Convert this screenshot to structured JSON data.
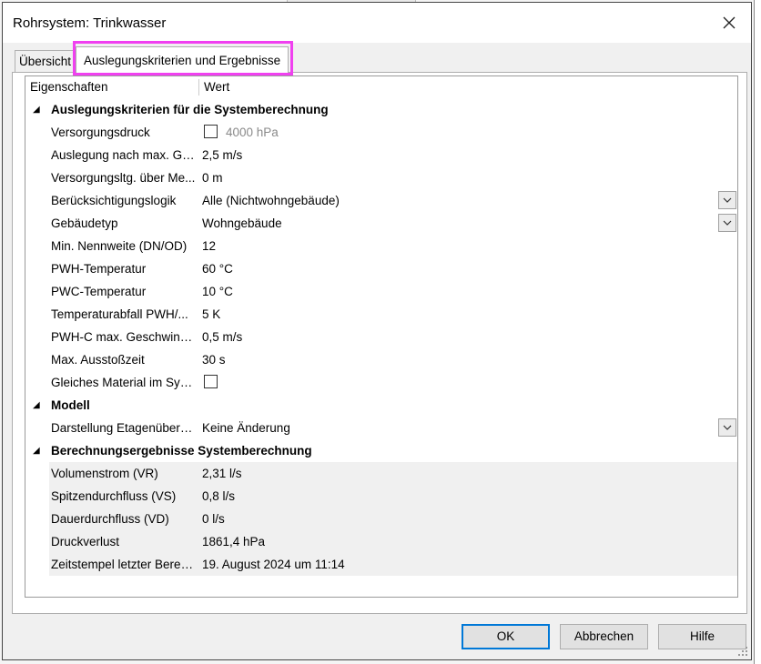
{
  "window": {
    "title": "Rohrsystem: Trinkwasser",
    "close_icon": "close-icon"
  },
  "tabs": [
    {
      "label": "Übersicht",
      "active": false
    },
    {
      "label": "Auslegungskriterien und Ergebnisse",
      "active": true
    }
  ],
  "grid": {
    "headers": {
      "property": "Eigenschaften",
      "value": "Wert"
    },
    "categories": [
      {
        "title": "Auslegungskriterien für die Systemberechnung",
        "rows": [
          {
            "label": "Versorgungsdruck",
            "value": "4000 hPa",
            "checkbox": true,
            "checked": false
          },
          {
            "label": "Auslegung nach max. Ge...",
            "value": "2,5 m/s"
          },
          {
            "label": "Versorgungsltg. über Me...",
            "value": "0 m"
          },
          {
            "label": "Berücksichtigungslogik",
            "value": "Alle (Nichtwohngebäude)",
            "dropdown": true
          },
          {
            "label": "Gebäudetyp",
            "value": "Wohngebäude",
            "dropdown": true
          },
          {
            "label": "Min. Nennweite (DN/OD)",
            "value": "12"
          },
          {
            "label": "PWH-Temperatur",
            "value": "60 °C"
          },
          {
            "label": "PWC-Temperatur",
            "value": "10 °C"
          },
          {
            "label": "Temperaturabfall PWH/...",
            "value": "5 K"
          },
          {
            "label": "PWH-C max. Geschwindi...",
            "value": "0,5 m/s"
          },
          {
            "label": "Max. Ausstoßzeit",
            "value": "30 s"
          },
          {
            "label": "Gleiches Material im Syst...",
            "value": "",
            "checkbox": true,
            "checked": false
          }
        ]
      },
      {
        "title": "Modell",
        "rows": [
          {
            "label": "Darstellung Etagenüberg...",
            "value": "Keine Änderung",
            "dropdown": true
          }
        ]
      },
      {
        "title": "Berechnungsergebnisse Systemberechnung",
        "rows": [
          {
            "label": "Volumenstrom (VR)",
            "value": "2,31 l/s",
            "readonly": true
          },
          {
            "label": "Spitzendurchfluss (VS)",
            "value": "0,8 l/s",
            "readonly": true
          },
          {
            "label": "Dauerdurchfluss (VD)",
            "value": "0 l/s",
            "readonly": true
          },
          {
            "label": "Druckverlust",
            "value": "1861,4 hPa",
            "readonly": true
          },
          {
            "label": "Zeitstempel letzter Berec...",
            "value": "19. August 2024 um 11:14",
            "readonly": true
          }
        ]
      }
    ]
  },
  "buttons": {
    "ok": "OK",
    "cancel": "Abbrechen",
    "help": "Hilfe"
  },
  "colors": {
    "accent": "#0078d7",
    "highlight": "#f040f0",
    "readonly_bg": "#f0f0f0"
  }
}
